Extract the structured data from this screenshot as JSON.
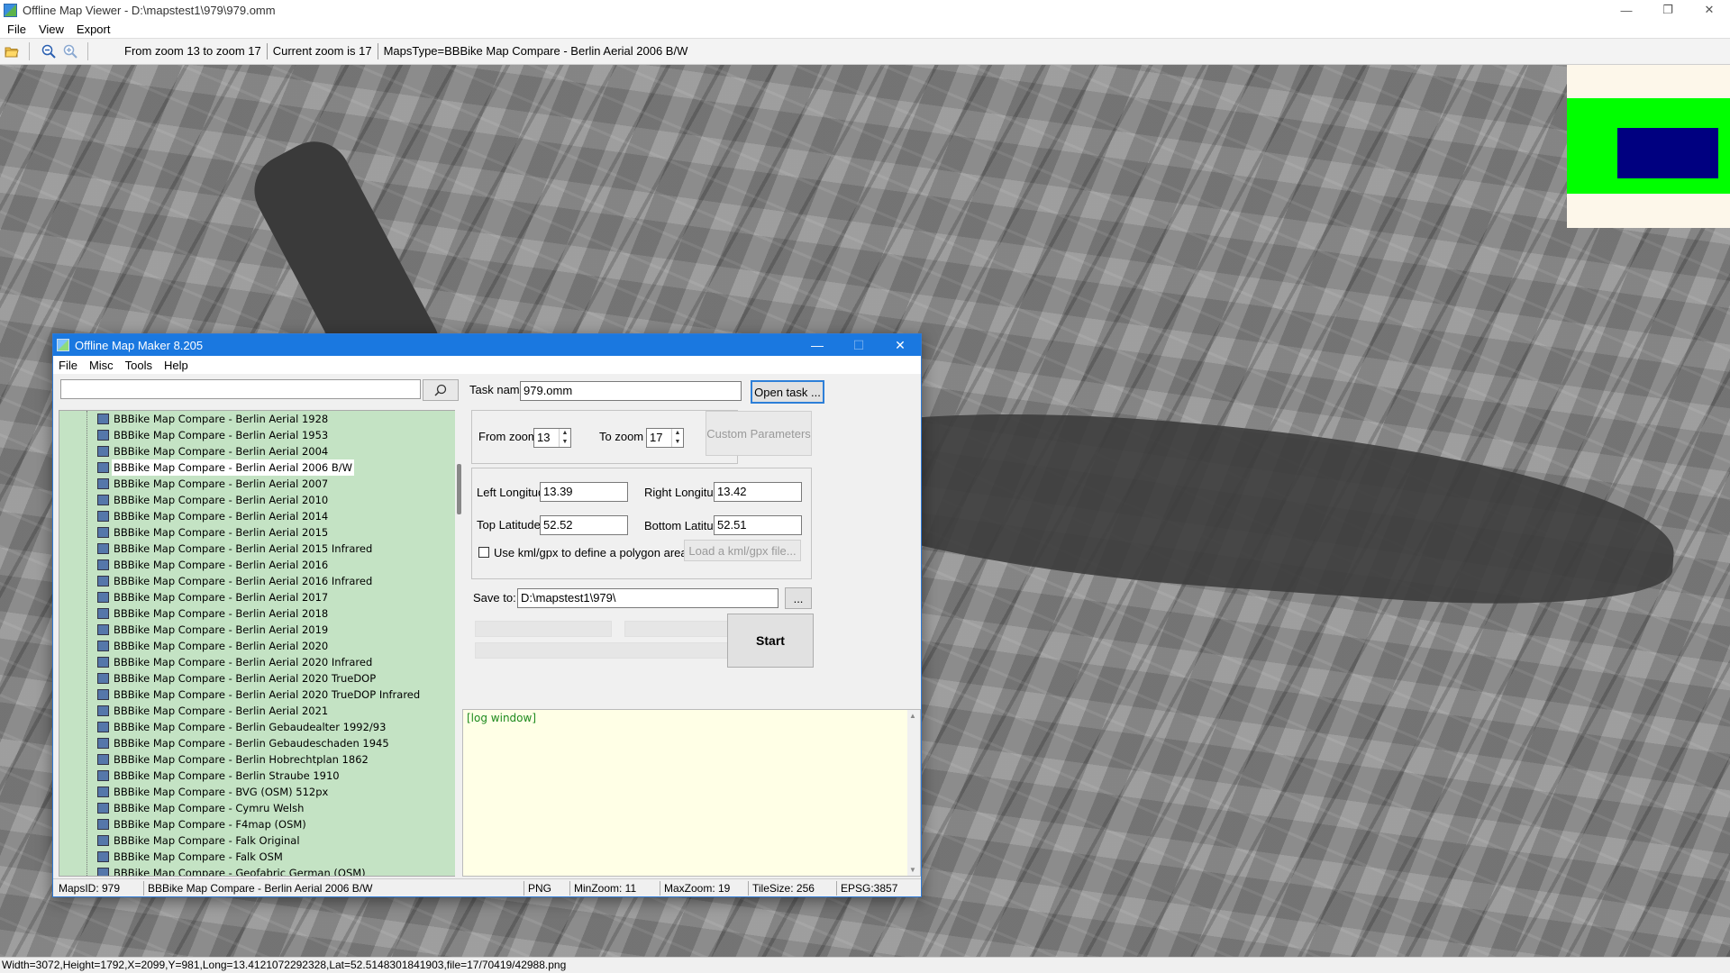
{
  "window": {
    "title": "Offline Map Viewer - D:\\mapstest1\\979\\979.omm",
    "minimize_icon": "minimize-icon",
    "maximize_icon": "restore-icon",
    "close_icon": "close-icon"
  },
  "menubar": {
    "items": [
      "File",
      "View",
      "Export"
    ]
  },
  "toolbar": {
    "open_icon": "folder-open-icon",
    "zoom_out_icon": "zoom-out-icon",
    "zoom_in_icon": "zoom-in-icon",
    "zoom_range": "From zoom 13 to zoom 17",
    "current_zoom": "Current zoom is 17",
    "maps_type": "MapsType=BBBike Map Compare - Berlin Aerial 2006 B/W"
  },
  "minimap": {
    "colors": {
      "background": "#fdf7ea",
      "frame": "#00ff00",
      "viewport": "#000080"
    }
  },
  "statusbar": {
    "text": "Width=3072,Height=1792,X=2099,Y=981,Long=13.4121072292328,Lat=52.5148301841903,file=17/70419/42988.png"
  },
  "dialog": {
    "title": "Offline Map Maker 8.205",
    "menu": [
      "File",
      "Misc",
      "Tools",
      "Help"
    ],
    "search": {
      "value": "",
      "icon": "search-icon"
    },
    "tree_items": [
      "BBBike Map Compare - Berlin Aerial 1928",
      "BBBike Map Compare - Berlin Aerial 1953",
      "BBBike Map Compare - Berlin Aerial 2004",
      "BBBike Map Compare - Berlin Aerial 2006 B/W",
      "BBBike Map Compare - Berlin Aerial 2007",
      "BBBike Map Compare - Berlin Aerial 2010",
      "BBBike Map Compare - Berlin Aerial 2014",
      "BBBike Map Compare - Berlin Aerial 2015",
      "BBBike Map Compare - Berlin Aerial 2015 Infrared",
      "BBBike Map Compare - Berlin Aerial 2016",
      "BBBike Map Compare - Berlin Aerial 2016 Infrared",
      "BBBike Map Compare - Berlin Aerial 2017",
      "BBBike Map Compare - Berlin Aerial 2018",
      "BBBike Map Compare - Berlin Aerial 2019",
      "BBBike Map Compare - Berlin Aerial 2020",
      "BBBike Map Compare - Berlin Aerial 2020 Infrared",
      "BBBike Map Compare - Berlin Aerial 2020 TrueDOP",
      "BBBike Map Compare - Berlin Aerial 2020 TrueDOP Infrared",
      "BBBike Map Compare - Berlin Aerial 2021",
      "BBBike Map Compare - Berlin Gebaudealter 1992/93",
      "BBBike Map Compare - Berlin Gebaudeschaden 1945",
      "BBBike Map Compare - Berlin Hobrechtplan 1862",
      "BBBike Map Compare - Berlin Straube 1910",
      "BBBike Map Compare - BVG (OSM) 512px",
      "BBBike Map Compare - Cymru Welsh",
      "BBBike Map Compare - F4map (OSM)",
      "BBBike Map Compare - Falk Original",
      "BBBike Map Compare - Falk OSM",
      "BBBike Map Compare - Geofabric German (OSM)"
    ],
    "selected_index": 3,
    "task_name_label": "Task name",
    "task_name": "979.omm",
    "open_task_button": "Open task ...",
    "from_zoom_label": "From zoom",
    "from_zoom": "13",
    "to_zoom_label": "To zoom",
    "to_zoom": "17",
    "custom_params_button": "Custom Parameters",
    "left_lon_label": "Left Longitude",
    "left_lon": "13.39",
    "right_lon_label": "Right Longitude",
    "right_lon": "13.42",
    "top_lat_label": "Top Latitude",
    "top_lat": "52.52",
    "bottom_lat_label": "Bottom Latitude",
    "bottom_lat": "52.51",
    "kml_checkbox_label": "Use kml/gpx to define a polygon area",
    "kml_checked": false,
    "load_kml_button": "Load a kml/gpx file...",
    "save_to_label": "Save to:",
    "save_to": "D:\\mapstest1\\979\\",
    "browse_button": "...",
    "start_button": "Start",
    "log_text": "[log window]",
    "status": {
      "maps_id": "MapsID: 979",
      "maps_name": "BBBike Map Compare - Berlin Aerial 2006 B/W",
      "format": "PNG",
      "min_zoom": "MinZoom: 11",
      "max_zoom": "MaxZoom: 19",
      "tile_size": "TileSize: 256",
      "epsg": "EPSG:3857"
    }
  }
}
